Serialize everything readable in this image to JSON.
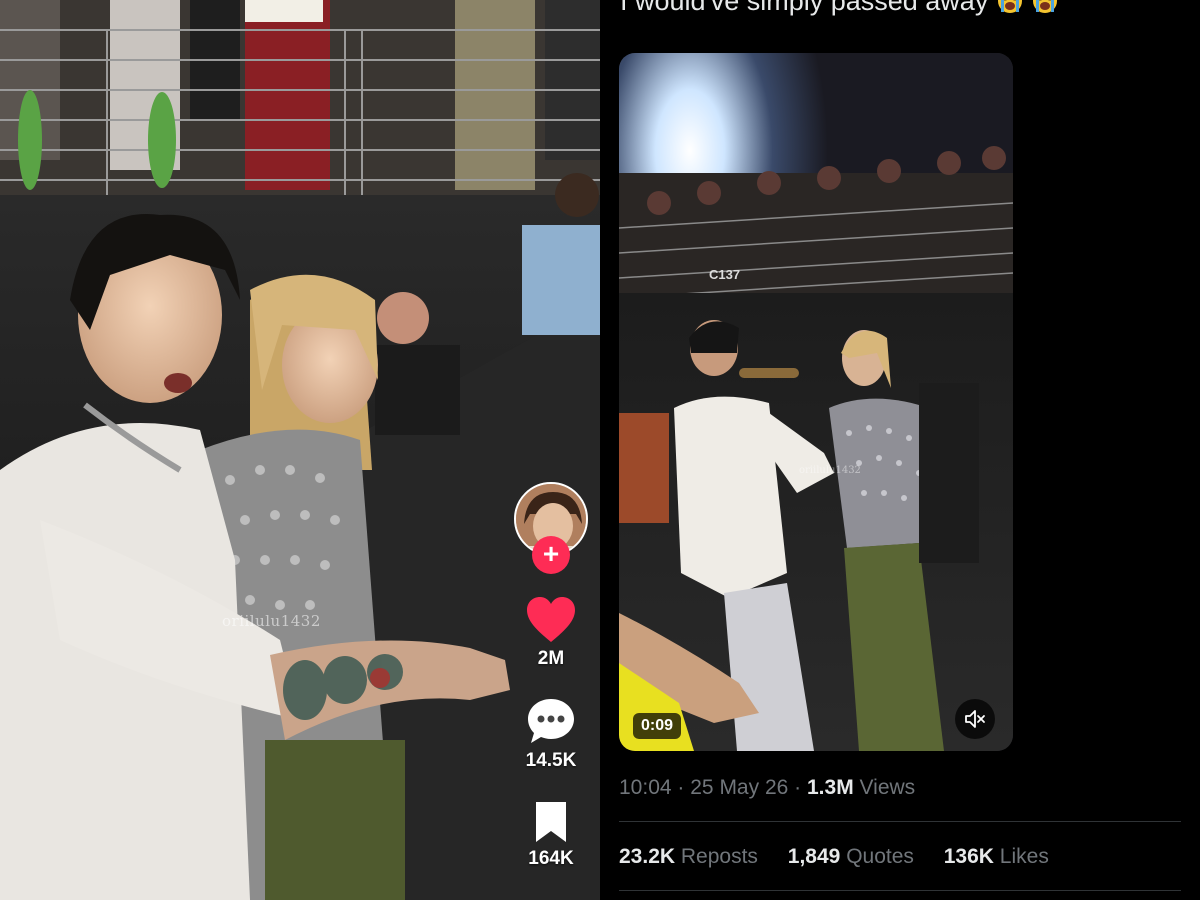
{
  "tiktok": {
    "watermark": "oriilulu1432",
    "actions": {
      "follow_symbol": "+",
      "likes": "2M",
      "comments": "14.5K",
      "saves": "164K"
    },
    "colors": {
      "like": "#fe2c55",
      "follow": "#fe2c55"
    },
    "icons": [
      "heart-icon",
      "comment-icon",
      "bookmark-icon",
      "plus-icon"
    ]
  },
  "tweet": {
    "text": "I would've simply passed away",
    "emojis": [
      "loudly-crying-face",
      "loudly-crying-face"
    ],
    "video": {
      "duration": "0:09",
      "watermark": "oriilulu1432",
      "banner_text": "C137"
    },
    "meta": {
      "time": "10:04",
      "separator": "·",
      "date": "25 May 26",
      "views_count": "1.3M",
      "views_label": "Views"
    },
    "stats": {
      "reposts_count": "23.2K",
      "reposts_label": "Reposts",
      "quotes_count": "1,849",
      "quotes_label": "Quotes",
      "likes_count": "136K",
      "likes_label": "Likes"
    },
    "colors": {
      "text": "#e7e9ea",
      "secondary": "#71767b",
      "divider": "#2f3336"
    }
  }
}
